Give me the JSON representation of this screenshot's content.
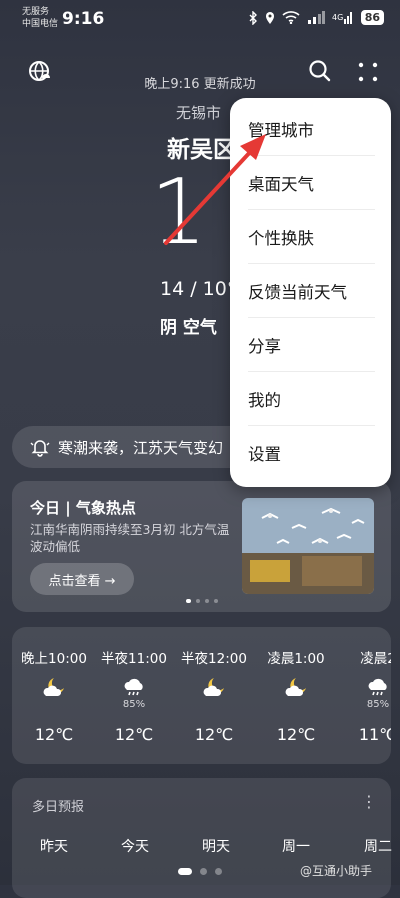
{
  "status_bar": {
    "carrier_line1": "无服务",
    "carrier_line2": "中国电信",
    "time": "9:16",
    "battery": "86"
  },
  "header": {
    "update_text": "晚上9:16 更新成功",
    "city": "无锡市",
    "district": "新吴区",
    "temperature": "1",
    "temp_range": "14 / 10°",
    "condition": "阴  空气"
  },
  "alert": {
    "text": "寒潮来袭，江苏天气变幻"
  },
  "news_card": {
    "title": "今日 | 气象热点",
    "description": "江南华南阴雨持续至3月初 北方气温波动偏低",
    "button_label": "点击查看 →"
  },
  "hourly": [
    {
      "label": "晚上10:00",
      "icon": "moon-cloud-icon",
      "precip": "",
      "temp": "12℃"
    },
    {
      "label": "半夜11:00",
      "icon": "rain-cloud-icon",
      "precip": "85%",
      "temp": "12℃"
    },
    {
      "label": "半夜12:00",
      "icon": "moon-cloud-icon",
      "precip": "",
      "temp": "12℃"
    },
    {
      "label": "凌晨1:00",
      "icon": "moon-cloud-icon",
      "precip": "",
      "temp": "12℃"
    },
    {
      "label": "凌晨2",
      "icon": "rain-cloud-icon",
      "precip": "85%",
      "temp": "11℃"
    }
  ],
  "daily": {
    "title": "多日预报",
    "days": [
      "昨天",
      "今天",
      "明天",
      "周一",
      "周二"
    ]
  },
  "menu": {
    "items": [
      "管理城市",
      "桌面天气",
      "个性换肤",
      "反馈当前天气",
      "分享",
      "我的",
      "设置"
    ]
  },
  "watermark": "@互通小助手",
  "colors": {
    "background": "#363a46",
    "menu_bg": "#ffffff",
    "annotation_arrow": "#e53935"
  }
}
